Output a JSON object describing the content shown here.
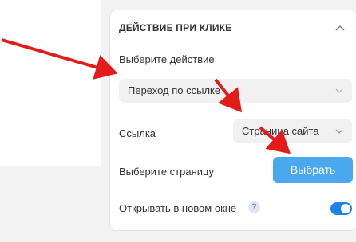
{
  "panel": {
    "title": "ДЕЙСТВИЕ ПРИ КЛИКЕ",
    "action_label": "Выберите действие",
    "action_value": "Переход по ссылке",
    "link_label": "Ссылка",
    "link_value": "Страница сайта",
    "page_label": "Выберите страницу",
    "choose_button": "Выбрать",
    "new_window_label": "Открывать в новом окне",
    "help_glyph": "?",
    "new_window_toggle_on": true
  },
  "colors": {
    "accent_button": "#4aa8ee",
    "toggle_on": "#1a85e4",
    "annotation_arrow": "#e51b1b"
  },
  "icons": [
    "chevron-up-icon",
    "chevron-down-icon",
    "help-icon"
  ]
}
